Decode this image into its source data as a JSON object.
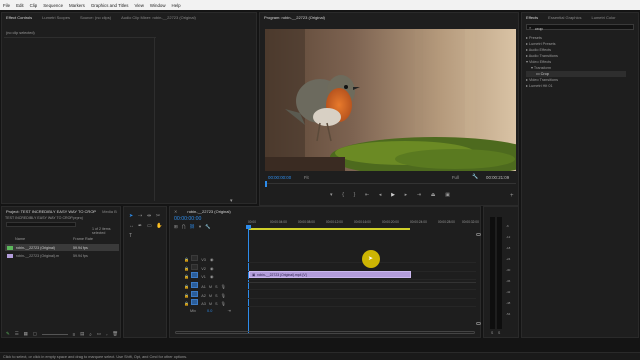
{
  "menu": [
    "File",
    "Edit",
    "Clip",
    "Sequence",
    "Markers",
    "Graphics and Titles",
    "View",
    "Window",
    "Help"
  ],
  "source_panel": {
    "tabs": [
      "Effect Controls",
      "Lumetri Scopes",
      "Source: (no clips)",
      "Audio Clip Mixer: robin-__22723 (Original)"
    ],
    "no_clip": "(no clip selected)"
  },
  "program": {
    "title": "Program: robin-__22723 (Original)",
    "timecode_left": "00:00:00:00",
    "fit": "Fit",
    "full": "Full",
    "timecode_right": "00:00:21:09"
  },
  "effects": {
    "tabs": [
      "Effects",
      "Essential Graphics",
      "Lumetri Color"
    ],
    "search": "crop",
    "tree": [
      "Presets",
      "Lumetri Presets",
      "Audio Effects",
      "Audio Transitions",
      "Video Effects",
      "Transform",
      "Crop",
      "Video Transitions",
      "Lumetri Hit 01"
    ]
  },
  "project": {
    "tabs": [
      "Project: TEST INCREDIBLY EASY WAY TO CROP",
      "Media B"
    ],
    "file": "TEST INCREDIBLY EASY WAY TO CROP.prproj",
    "count": "1 of 2 items selected",
    "columns": [
      "Name",
      "Frame Rate"
    ],
    "rows": [
      {
        "name": "robin-__22723 (Original)",
        "fps": "59.94 fps"
      },
      {
        "name": "robin-__22723 (Original).m",
        "fps": "59.94 fps"
      }
    ]
  },
  "timeline": {
    "tab": "robin-__22723 (Original)",
    "timecode": "00:00:00:00",
    "ruler": [
      "00:00",
      "00:00:04:00",
      "00:00:08:00",
      "00:00:12:00",
      "00:00:16:00",
      "00:00:20:00",
      "00:00:24:00",
      "00:00:28:00",
      "00:00:32:00"
    ],
    "tracks": [
      "V3",
      "V2",
      "V1",
      "A1",
      "A2",
      "A3",
      "Mix"
    ],
    "clip_label": "robin-__22723 (Original).mp4 [V]",
    "mix_value": "0.0"
  },
  "meter": {
    "scale": [
      "-6",
      "-12",
      "-18",
      "-24",
      "-30",
      "-36",
      "-42",
      "-48",
      "-54"
    ],
    "labels": [
      "S",
      "S"
    ]
  },
  "status": "Click to select, or click in empty space and drag to marquee select. Use Shift, Opt, and Cmd for other options.",
  "colors": {
    "accent": "#2d8ceb",
    "clip": "#b39ddb",
    "cursor": "#f2d400"
  }
}
